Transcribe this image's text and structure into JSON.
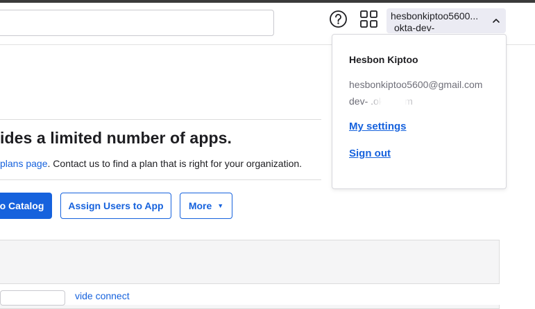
{
  "header": {
    "search_value": "",
    "user": {
      "name_truncated": "hesbonkiptoo5600...",
      "org": "okta-dev-"
    },
    "icons": {
      "help": "help-circle-icon",
      "apps": "apps-grid-icon",
      "chevron": "chevron-up-icon"
    }
  },
  "main": {
    "headline": "ides a limited number of apps.",
    "sub_link": "plans page",
    "sub_text": ". Contact us to find a plan that is right for your organization.",
    "buttons": {
      "browse_catalog": "o Catalog",
      "assign_users": "Assign Users to App",
      "more": "More",
      "more_caret": "▼"
    },
    "cut_link": "vide connect"
  },
  "dropdown": {
    "name": "Hesbon Kiptoo",
    "email": "hesbonkiptoo5600@gmail.com",
    "org": "dev-                   .okta.com",
    "my_settings": "My settings",
    "sign_out": "Sign out"
  },
  "colors": {
    "accent": "#1662dd",
    "chip_bg": "#ebebf3",
    "muted_text": "#6e6e78"
  }
}
